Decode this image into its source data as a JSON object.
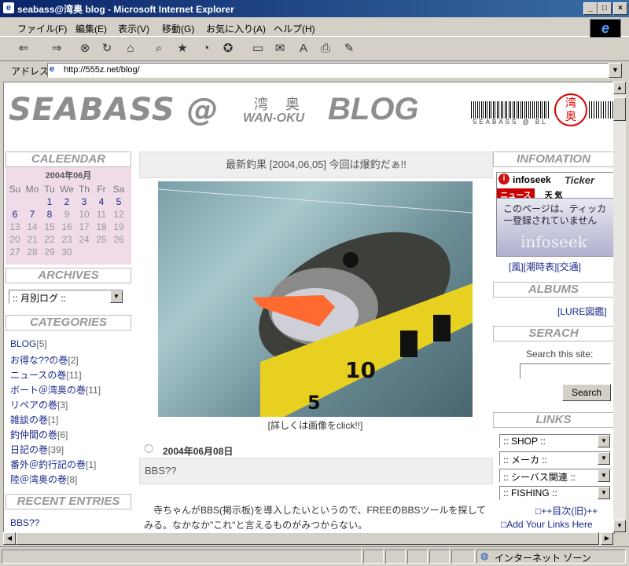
{
  "window": {
    "title": "seabass@湾奥 blog - Microsoft Internet Explorer",
    "minimize": "_",
    "maximize": "□",
    "close": "×"
  },
  "menu": [
    "ファイル(F)",
    "編集(E)",
    "表示(V)",
    "移動(G)",
    "お気に入り(A)",
    "ヘルプ(H)"
  ],
  "address": {
    "label": "アドレス",
    "url": "http://555z.net/blog/"
  },
  "status": {
    "zone": "インターネット ゾーン"
  },
  "header": {
    "logo": "SEABASS @",
    "kanji": "湾奥",
    "sub": "WAN-OKU",
    "blog": "BLOG",
    "barcode_text": "SEABASS @ BL",
    "seal": "湾奥"
  },
  "calendar": {
    "heading": "CALEENDAR",
    "month": "2004年06月",
    "weekdays": [
      "Su",
      "Mo",
      "Tu",
      "We",
      "Th",
      "Fr",
      "Sa"
    ],
    "weeks": [
      [
        "",
        "",
        "1",
        "2",
        "3",
        "4",
        "5"
      ],
      [
        "6",
        "7",
        "8",
        "9",
        "10",
        "11",
        "12"
      ],
      [
        "13",
        "14",
        "15",
        "16",
        "17",
        "18",
        "19"
      ],
      [
        "20",
        "21",
        "22",
        "23",
        "24",
        "25",
        "26"
      ],
      [
        "27",
        "28",
        "29",
        "30",
        "",
        "",
        ""
      ]
    ]
  },
  "archives": {
    "heading": "ARCHIVES",
    "selected": "::  月別ログ  ::"
  },
  "categories": {
    "heading": "CATEGORIES",
    "items": [
      {
        "name": "BLOG",
        "count": "[5]"
      },
      {
        "name": "お得な??の巻",
        "count": "[2]"
      },
      {
        "name": "ニュースの巻",
        "count": "[11]"
      },
      {
        "name": "ボート＠湾奥の巻",
        "count": "[11]"
      },
      {
        "name": "リペアの巻",
        "count": "[3]"
      },
      {
        "name": "雑談の巻",
        "count": "[1]"
      },
      {
        "name": "釣仲間の巻",
        "count": "[6]"
      },
      {
        "name": "日記の巻",
        "count": "[39]"
      },
      {
        "name": "番外＠釣行記の巻",
        "count": "[1]"
      },
      {
        "name": "陸＠湾奥の巻",
        "count": "[8]"
      }
    ]
  },
  "recent": {
    "heading": "RECENT ENTRIES",
    "items": [
      "BBS??"
    ]
  },
  "main": {
    "entry_title": "最新釣果 [2004,06,05] 今回は爆釣だぁ!!",
    "caption": "[詳しくは画像をclick!!]",
    "date": "2004年06月08日",
    "entry2_title": "BBS??",
    "body": "　寺ちゃんがBBS(掲示板)を導入したいというので、FREEのBBSツールを探してみる。なかなか\"これ\"と言えるものがみつからない。"
  },
  "information": {
    "heading": "INFOMATION",
    "ticker_brand": "infoseek",
    "ticker_word": "Ticker",
    "tab_news": "ニュース",
    "tab_weather": "天 気",
    "message": "このページは、ティッカー登録されていません",
    "watermark": "infoseek",
    "links": "[風][潮時表][交通]"
  },
  "albums": {
    "heading": "ALBUMS",
    "link": "[LURE図鑑]"
  },
  "search": {
    "heading": "SERACH",
    "label": "Search this site:",
    "button": "Search"
  },
  "links": {
    "heading": "LINKS",
    "selects": [
      ":: SHOP ::",
      ":: メーカ ::",
      ":: シーバス関連 ::",
      ":: FISHING ::"
    ],
    "prev_next": "□++目次(旧)++",
    "add": "□Add Your Links Here"
  }
}
